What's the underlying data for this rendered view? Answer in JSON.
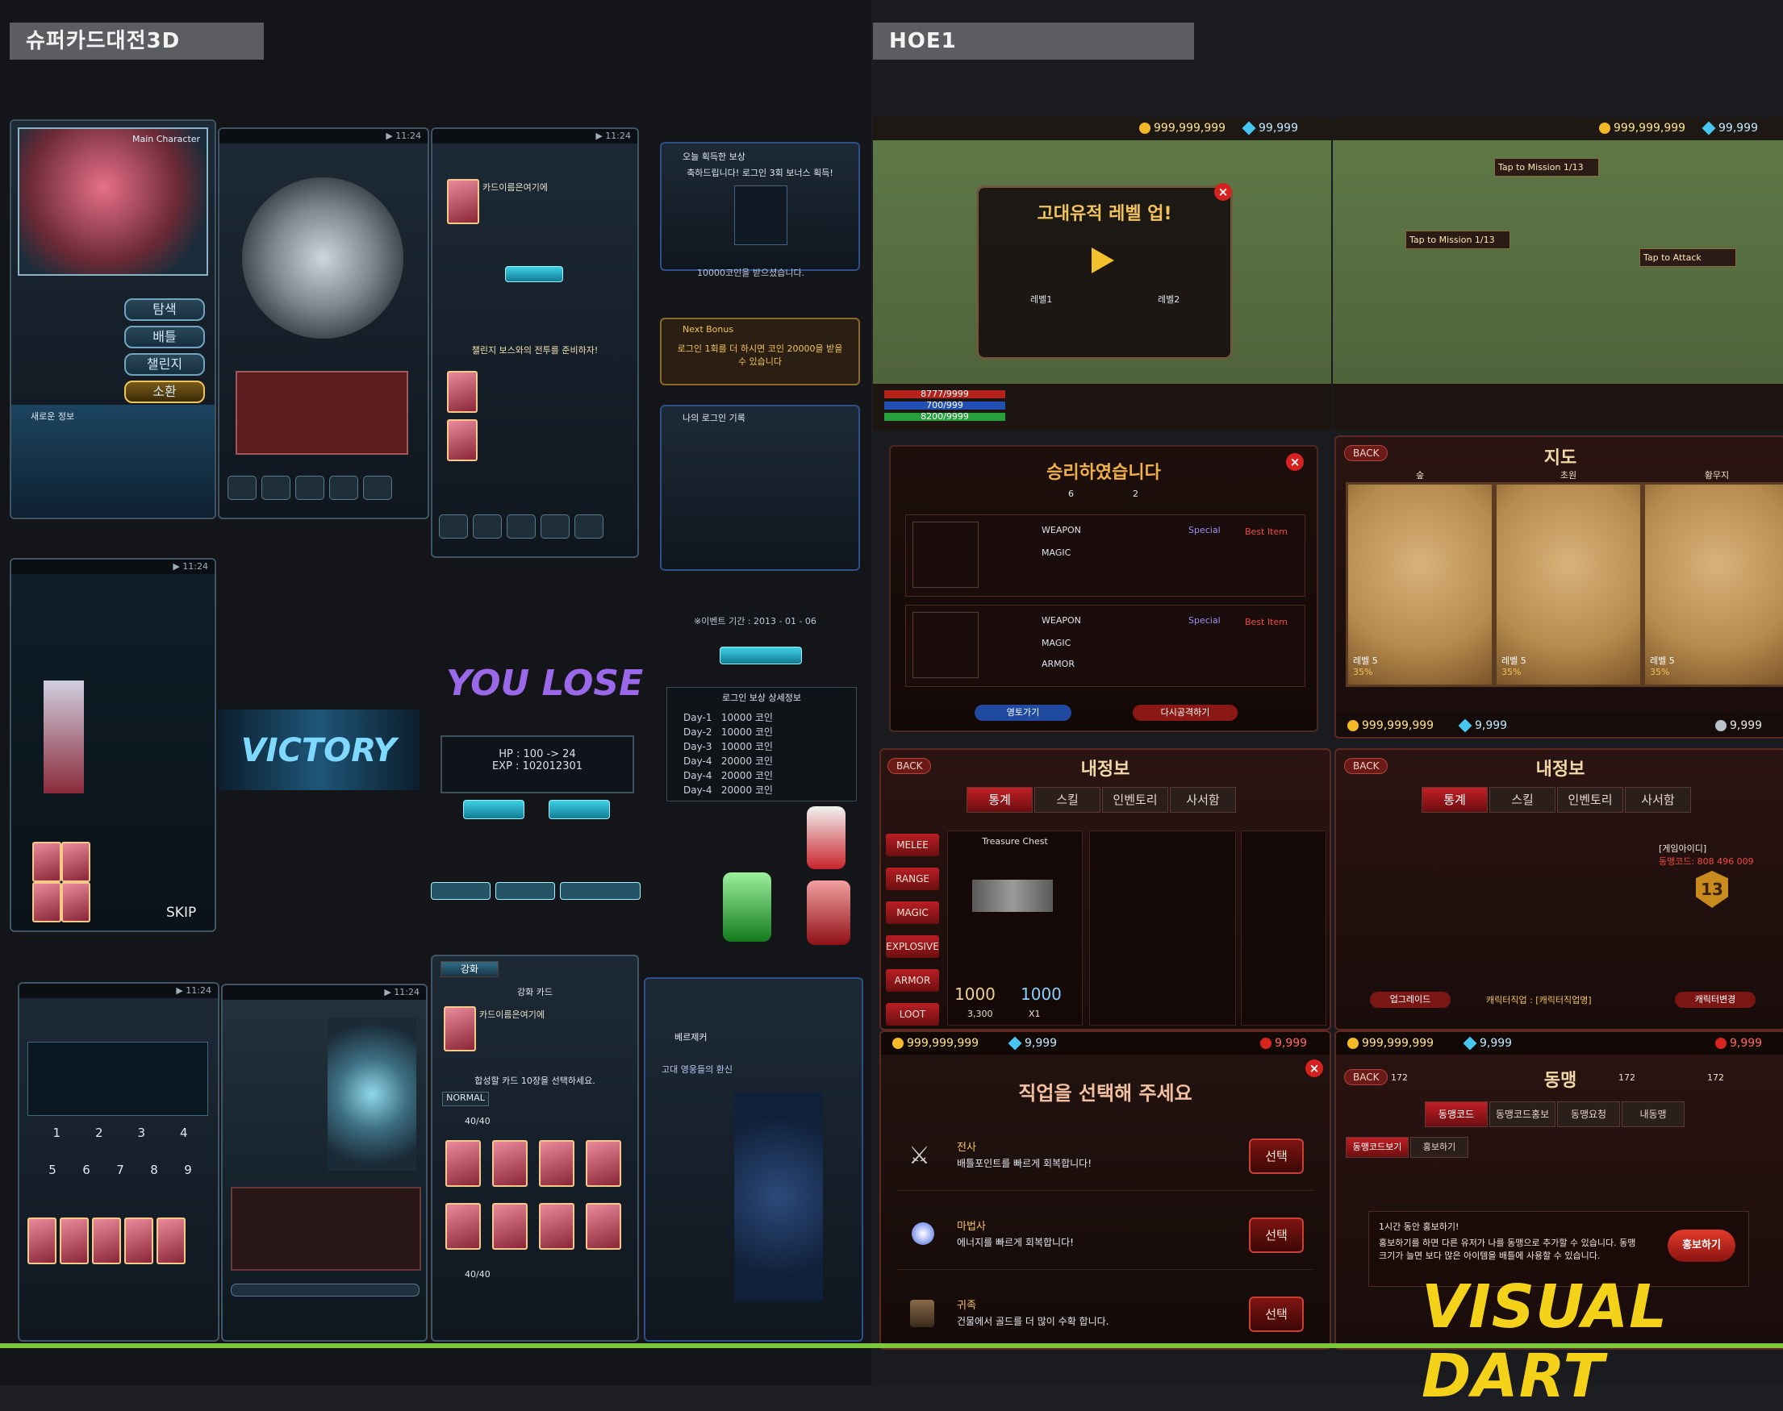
{
  "left_section": {
    "title": "슈퍼카드대전3D",
    "main_character": "Main Character",
    "screen1_buttons": [
      "탐색",
      "배틀",
      "챌린지",
      "소환"
    ],
    "new_info": "새로운 정보",
    "victory_text": "VICTORY",
    "you_lose_text": "YOU LOSE",
    "lose_result": "HP : 100 -> 24\nEXP : 102012301",
    "skip_label": "SKIP",
    "upgrade_tab": "강화",
    "upgrade_card": "강화 카드",
    "card_name": "카드이름은여기에",
    "select_prompt": "합성할 카드 10장을 선택하세요.",
    "sort_normal": "NORMAL",
    "count_a": "40/40",
    "count_b": "40/40",
    "berserker": "베르제커",
    "berserker_desc": "고대 영웅들의 환신",
    "boss_ready": "챌린지 보스와의 전투를 준비하자!",
    "login_panel": {
      "today_reward": "오늘 획득한 보상",
      "congrats": "축하드립니다! 로그인 3회 보너스 획득!",
      "got_coin": "10000코인을 받으셨습니다.",
      "next_bonus": "Next Bonus",
      "next_bonus_desc": "로그인 1회를 더 하시면 코인 20000을 받을 수 있습니다",
      "my_login_record": "나의 로그인 기록",
      "event_period": "※이벤트 기간 : 2013 - 01 - 06",
      "detail_title": "로그인 보상 상세정보",
      "days": [
        {
          "day": "Day-1",
          "reward": "10000 코인"
        },
        {
          "day": "Day-2",
          "reward": "10000 코인"
        },
        {
          "day": "Day-3",
          "reward": "10000 코인"
        },
        {
          "day": "Day-4",
          "reward": "20000 코인"
        },
        {
          "day": "Day-4",
          "reward": "20000 코인"
        },
        {
          "day": "Day-4",
          "reward": "20000 코인"
        }
      ]
    }
  },
  "right_section": {
    "title": "HOE1",
    "top_hud": {
      "gold": "999,999,999",
      "gems": "99,999",
      "hp": "8777/9999",
      "mp": "700/999",
      "exp": "8200/9999"
    },
    "level_up": {
      "title": "고대유적 레벨 업!",
      "from": "레벨1",
      "to": "레벨2"
    },
    "mission": {
      "tap_mission": "Tap to Mission 1/13",
      "tap_attack": "Tap to Attack"
    },
    "victory_dialog": {
      "title": "승리하였습니다",
      "stat_a": "6",
      "stat_b": "2",
      "weapon": "WEAPON",
      "magic": "MAGIC",
      "armor": "ARMOR",
      "special": "Special",
      "best_item": "Best Item",
      "btn_left": "영토가기",
      "btn_right": "다시공격하기"
    },
    "map": {
      "back": "BACK",
      "title": "지도",
      "regions": [
        "숲",
        "초원",
        "황무지"
      ],
      "level": "레벨 5",
      "percent": "35%",
      "gold": "999,999,999",
      "gems": "9,999",
      "silver": "9,999"
    },
    "inventory": {
      "back": "BACK",
      "title": "내정보",
      "tabs": [
        "통계",
        "스킬",
        "인벤토리",
        "사서함"
      ],
      "categories": [
        "MELEE",
        "RANGE",
        "MAGIC",
        "EXPLOSIVE",
        "ARMOR",
        "LOOT"
      ],
      "treasure_chest": "Treasure Chest",
      "attack": "1000",
      "defense": "1000",
      "price": "3,300",
      "qty": "X1"
    },
    "profile": {
      "back": "BACK",
      "title": "내정보",
      "tabs": [
        "통계",
        "스킬",
        "인벤토리",
        "사서함"
      ],
      "game_id": "[게임아이디]",
      "ally_code": "동맹코드: 808 496 009",
      "level": "13",
      "upgrade_btn": "업그레이드",
      "job": "캐릭터직업 : [캐릭터직업명]",
      "change_btn": "캐릭터변경"
    },
    "job_select": {
      "gold": "999,999,999",
      "gems": "9,999",
      "red": "9,999",
      "title": "직업을 선택해 주세요",
      "jobs": [
        {
          "name": "전사",
          "desc": "배틀포인트를 빠르게 회복합니다!",
          "btn": "선택"
        },
        {
          "name": "마법사",
          "desc": "에너지를 빠르게 회복합니다!",
          "btn": "선택"
        },
        {
          "name": "귀족",
          "desc": "건물에서 골드를 더 많이 수확 합니다.",
          "btn": "선택"
        }
      ]
    },
    "alliance": {
      "gold": "999,999,999",
      "gems": "9,999",
      "red": "9,999",
      "back": "BACK",
      "title": "동맹",
      "count1": "172",
      "count2": "172",
      "count3": "172",
      "tabs": [
        "동맹코드",
        "동맹코드홍보",
        "동맹요청",
        "내동맹"
      ],
      "sub_tabs": [
        "동맹코드보기",
        "홍보하기"
      ],
      "promo_title": "1시간 동안 홍보하기!",
      "promo_desc": "홍보하기를 하면 다른 유저가 나를 동맹으로 추가할 수 있습니다. 동맹 크기가 늘면 보다 많은 아이템을 배틀에 사용할 수 있습니다.",
      "promo_btn": "홍보하기"
    },
    "watermark": "VISUAL DART"
  },
  "colors": {
    "accent_cyan": "#3fd1e6",
    "accent_red": "#c11f24",
    "gold": "#f2c35c",
    "watermark_yellow": "#f5d21a",
    "divider_green": "#7cc83a"
  },
  "icons": [
    "close-icon",
    "coin-icon",
    "gem-icon",
    "help-icon",
    "lightning-icon",
    "sword-icon",
    "magic-orb-icon",
    "gun-icon"
  ]
}
